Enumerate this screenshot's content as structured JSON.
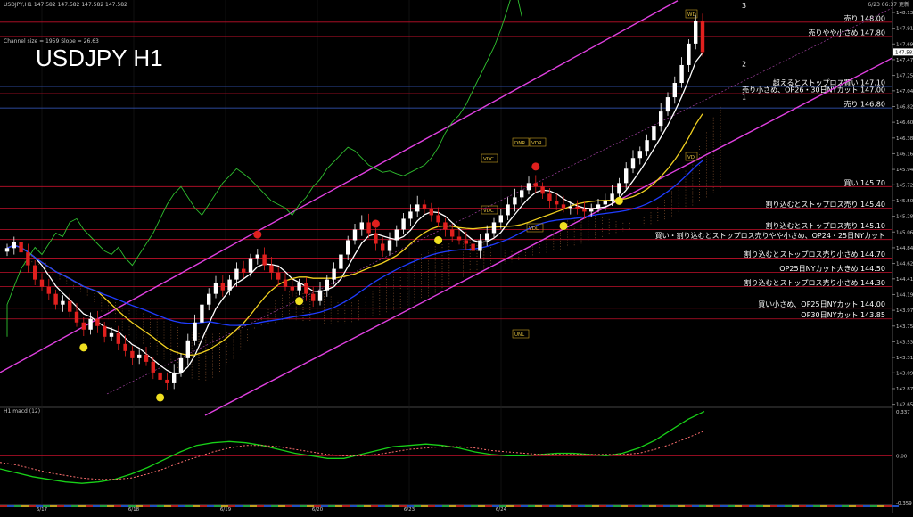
{
  "header": {
    "symbol_line": "USDJPY,H1  147.582 147.582 147.582 147.582",
    "timestamp": "6/23 06:37 更新",
    "channel_info": "Channel size = 1959  Slope = 26.63",
    "chart_title": "USDJPY H1",
    "macd_label": "H1 macd (12)"
  },
  "colors": {
    "background": "#000000",
    "bull_candle": "#ffffff",
    "bear_candle": "#e0201e",
    "channel": "#e040e0",
    "level_red": "#c0102a",
    "level_blue": "#3a5fcd",
    "ma_fast": "#ffffff",
    "ma_mid": "#f0d020",
    "ma_slow": "#1f3cff",
    "chikou": "#2fbf2f",
    "macd_line": "#18d018",
    "signal_line": "#ff7070"
  },
  "chart_data": [
    {
      "type": "candlestick",
      "symbol": "USDJPY",
      "timeframe": "H1",
      "ylim": [
        142.675,
        148.135
      ],
      "y_ticks": [
        148.135,
        147.915,
        147.695,
        147.475,
        147.255,
        147.04,
        146.82,
        146.6,
        146.38,
        146.16,
        145.94,
        145.725,
        145.505,
        145.285,
        145.065,
        144.845,
        144.625,
        144.41,
        144.19,
        143.97,
        143.75,
        143.53,
        143.31,
        143.095,
        142.875,
        142.655
      ],
      "current_price_label": "147.582",
      "x_ticks": [
        "6/17",
        "6/18",
        "6/19",
        "6/20",
        "6/23",
        "6/24"
      ],
      "levels": [
        {
          "price": 148.0,
          "label": "売り 148.00",
          "color": "#c0102a"
        },
        {
          "price": 147.8,
          "label": "売りやや小さめ 147.80",
          "color": "#c0102a"
        },
        {
          "price": 147.1,
          "label": "超えるとストップロス買い 147.10",
          "color": "#3a5fcd"
        },
        {
          "price": 147.0,
          "label": "売り小さめ、OP26・30日NYカット 147.00",
          "color": "#c0102a"
        },
        {
          "price": 146.8,
          "label": "売り 146.80",
          "color": "#3a5fcd"
        },
        {
          "price": 145.7,
          "label": "買い 145.70",
          "color": "#c0102a"
        },
        {
          "price": 145.4,
          "label": "割り込むとストップロス売り 145.40",
          "color": "#c0102a"
        },
        {
          "price": 145.1,
          "label": "割り込むとストップロス売り 145.10",
          "color": "#c0102a"
        },
        {
          "price": 144.96,
          "label": "買い・割り込むとストップロス売りやや小さめ、OP24・25日NYカット",
          "color": "#c0102a"
        },
        {
          "price": 144.7,
          "label": "割り込むとストップロス売り小さめ 144.70",
          "color": "#c0102a"
        },
        {
          "price": 144.5,
          "label": "OP25日NYカット大きめ 144.50",
          "color": "#c0102a"
        },
        {
          "price": 144.3,
          "label": "割り込むとストップロス売り小さめ 144.30",
          "color": "#c0102a"
        },
        {
          "price": 144.0,
          "label": "買い小さめ、OP25日NYカット 144.00",
          "color": "#c0102a"
        },
        {
          "price": 143.85,
          "label": "OP30日NYカット 143.85",
          "color": "#c0102a"
        }
      ],
      "channel_labels": [
        "1",
        "2",
        "3"
      ],
      "tags": [
        "DNR",
        "VDR",
        "VDC",
        "VDC",
        "VDL",
        "UNL",
        "WD",
        "VD"
      ],
      "closes": [
        144.84,
        144.92,
        144.78,
        144.6,
        144.4,
        144.3,
        144.2,
        144.05,
        144.1,
        143.95,
        143.8,
        143.7,
        143.85,
        143.75,
        143.6,
        143.65,
        143.5,
        143.4,
        143.3,
        143.35,
        143.25,
        143.1,
        143.0,
        142.95,
        143.1,
        143.3,
        143.55,
        143.8,
        144.05,
        144.2,
        144.35,
        144.25,
        144.4,
        144.55,
        144.5,
        144.7,
        144.75,
        144.6,
        144.5,
        144.4,
        144.3,
        144.25,
        144.35,
        144.2,
        144.1,
        144.25,
        144.4,
        144.55,
        144.75,
        144.95,
        145.1,
        145.2,
        145.05,
        144.9,
        144.8,
        144.95,
        145.1,
        145.25,
        145.35,
        145.45,
        145.38,
        145.3,
        145.2,
        145.1,
        145.0,
        144.95,
        144.9,
        144.8,
        144.95,
        145.05,
        145.2,
        145.3,
        145.45,
        145.55,
        145.65,
        145.75,
        145.7,
        145.6,
        145.5,
        145.45,
        145.4,
        145.42,
        145.38,
        145.35,
        145.4,
        145.45,
        145.5,
        145.6,
        145.75,
        145.95,
        146.1,
        146.2,
        146.35,
        146.55,
        146.75,
        146.95,
        147.15,
        147.4,
        147.7,
        148.02,
        147.58
      ],
      "series": [
        {
          "name": "MACD",
          "values": [
            -0.1,
            -0.13,
            -0.16,
            -0.18,
            -0.2,
            -0.21,
            -0.2,
            -0.18,
            -0.14,
            -0.09,
            -0.03,
            0.03,
            0.08,
            0.1,
            0.11,
            0.1,
            0.08,
            0.05,
            0.02,
            0.0,
            -0.02,
            -0.02,
            0.01,
            0.04,
            0.07,
            0.08,
            0.09,
            0.08,
            0.06,
            0.03,
            0.01,
            0.0,
            0.0,
            0.01,
            0.02,
            0.02,
            0.01,
            0.0,
            0.02,
            0.06,
            0.12,
            0.2,
            0.28,
            0.34
          ]
        },
        {
          "name": "Signal",
          "values": [
            -0.05,
            -0.07,
            -0.1,
            -0.13,
            -0.15,
            -0.17,
            -0.18,
            -0.18,
            -0.17,
            -0.14,
            -0.1,
            -0.05,
            -0.01,
            0.03,
            0.06,
            0.08,
            0.08,
            0.07,
            0.05,
            0.03,
            0.01,
            0.0,
            0.0,
            0.01,
            0.03,
            0.05,
            0.06,
            0.07,
            0.07,
            0.06,
            0.04,
            0.03,
            0.02,
            0.01,
            0.01,
            0.01,
            0.01,
            0.01,
            0.01,
            0.02,
            0.05,
            0.09,
            0.14,
            0.19
          ]
        }
      ],
      "macd_ylim": [
        -0.359,
        0.337
      ],
      "macd_ticks": [
        "0.337",
        "0.00",
        "-0.359"
      ]
    }
  ]
}
